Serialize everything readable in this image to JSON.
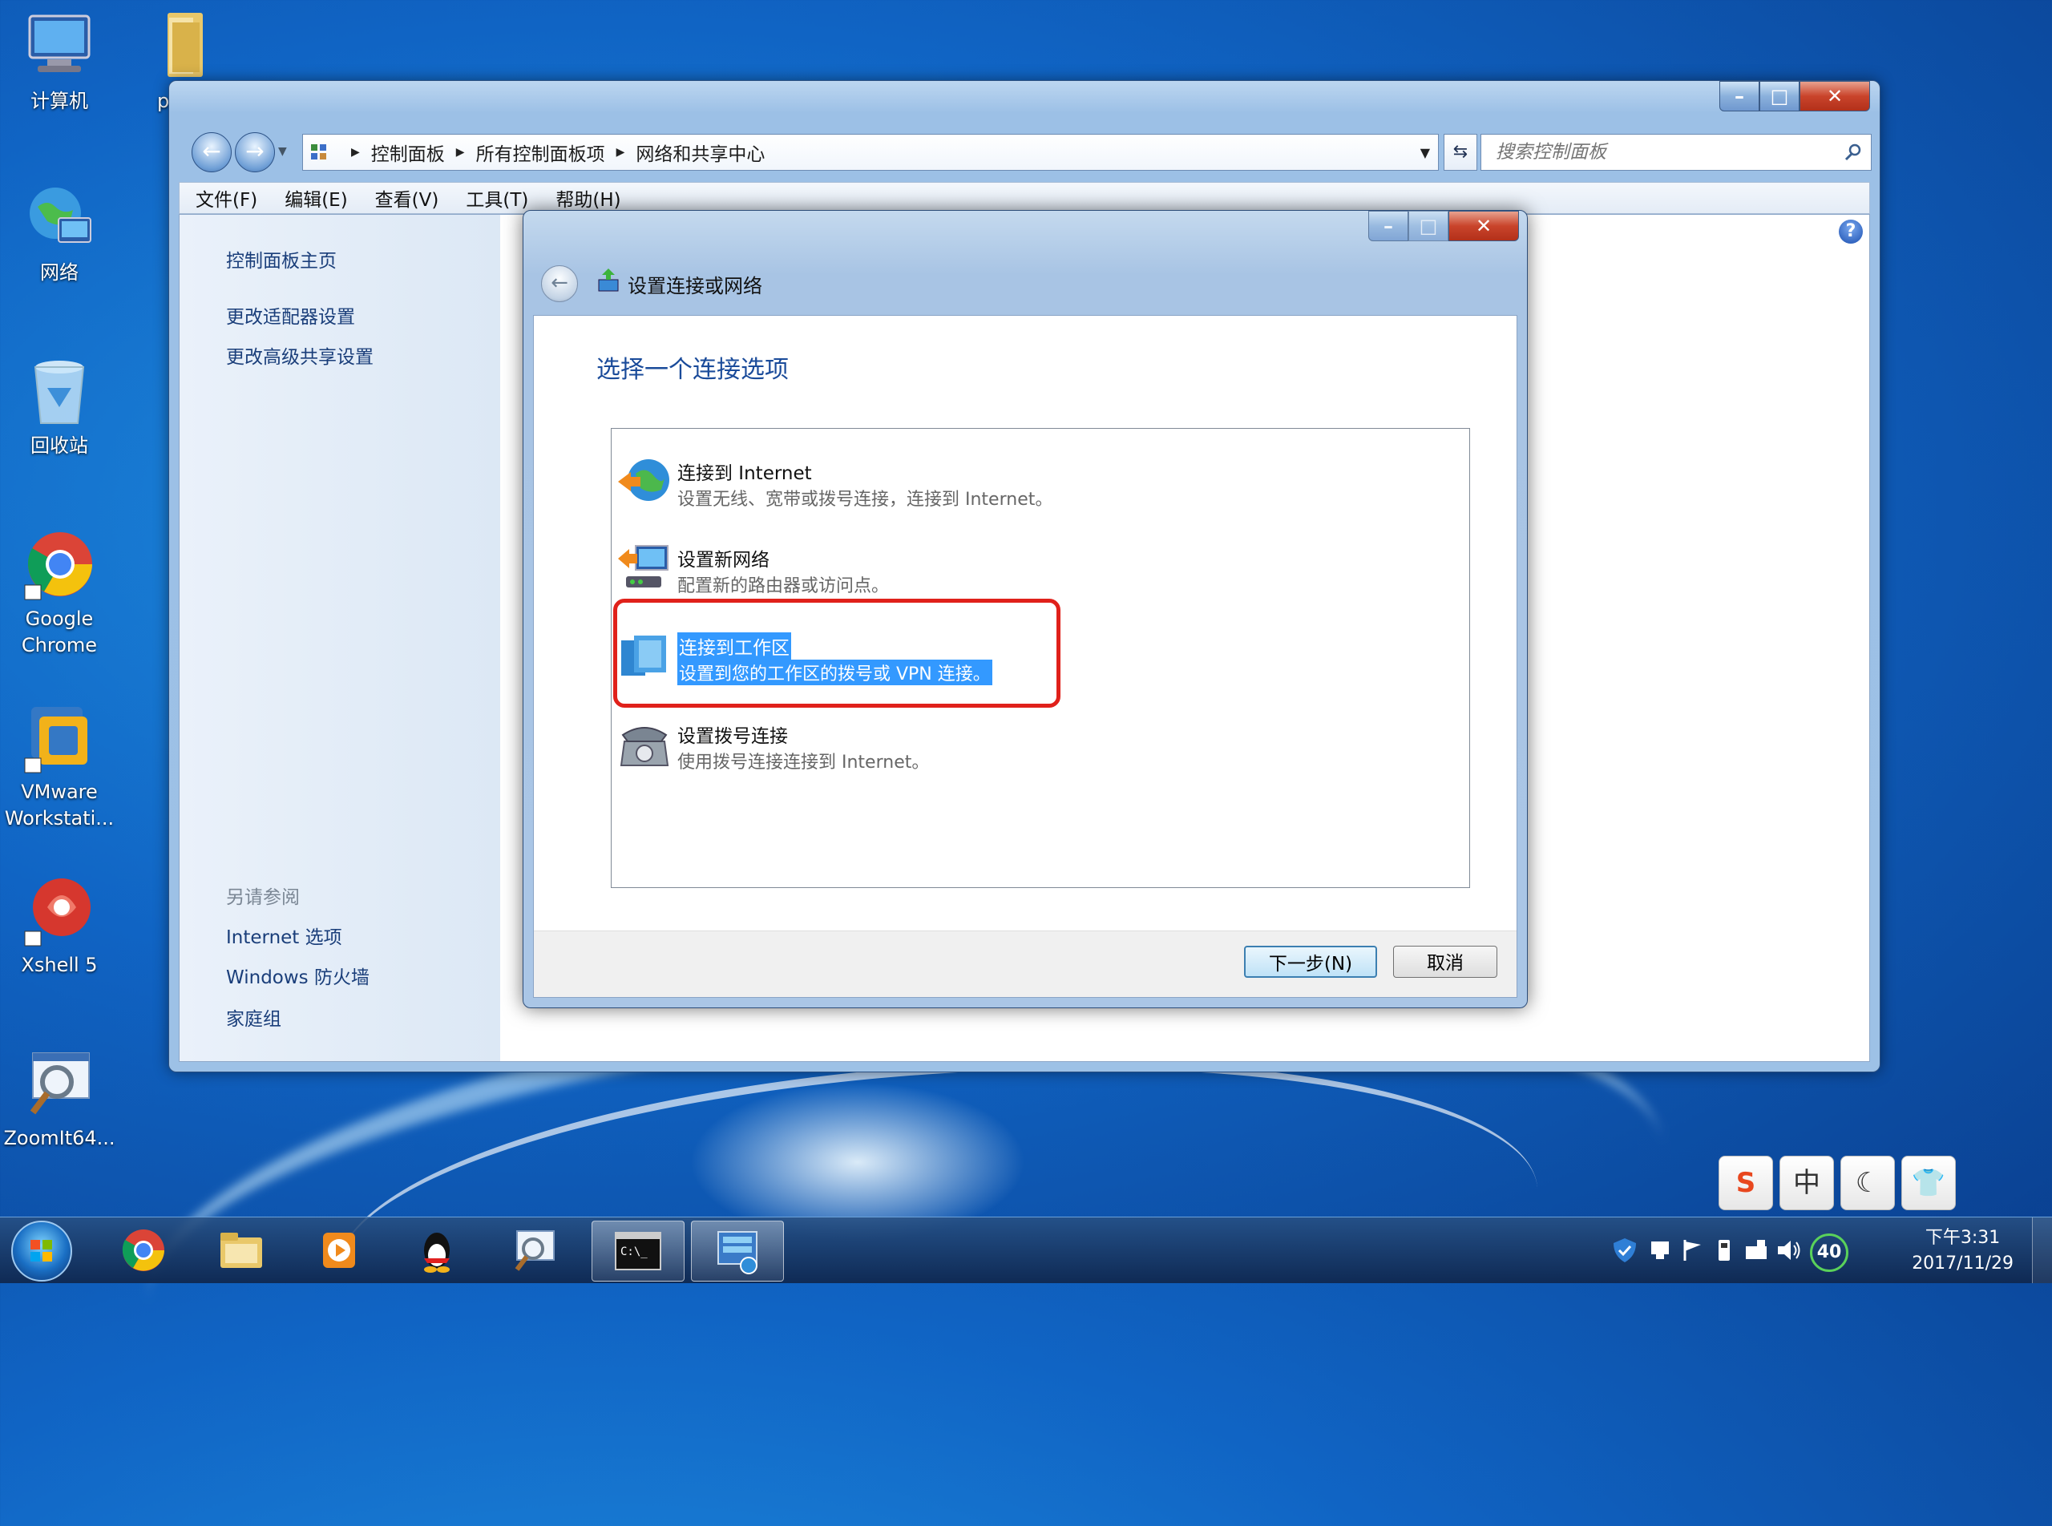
{
  "desktop": {
    "icons": [
      {
        "label": "计算机"
      },
      {
        "label": "p"
      },
      {
        "label": "网络"
      },
      {
        "label": "回收站"
      },
      {
        "label": "Google Chrome"
      },
      {
        "label": "VMware Workstati..."
      },
      {
        "label": "Xshell 5"
      },
      {
        "label": "ZoomIt64..."
      }
    ]
  },
  "explorer": {
    "breadcrumbs": [
      "控制面板",
      "所有控制面板项",
      "网络和共享中心"
    ],
    "search_placeholder": "搜索控制面板",
    "menu": [
      "文件(F)",
      "编辑(E)",
      "查看(V)",
      "工具(T)",
      "帮助(H)"
    ],
    "sidebar": {
      "links": [
        "控制面板主页",
        "更改适配器设置",
        "更改高级共享设置"
      ],
      "see_also_title": "另请参阅",
      "see_also": [
        "Internet 选项",
        "Windows 防火墙",
        "家庭组"
      ]
    }
  },
  "dialog": {
    "title": "设置连接或网络",
    "heading": "选择一个连接选项",
    "options": [
      {
        "title": "连接到 Internet",
        "desc": "设置无线、宽带或拨号连接，连接到 Internet。"
      },
      {
        "title": "设置新网络",
        "desc": "配置新的路由器或访问点。"
      },
      {
        "title": "连接到工作区",
        "desc": "设置到您的工作区的拨号或 VPN 连接。"
      },
      {
        "title": "设置拨号连接",
        "desc": "使用拨号连接连接到 Internet。"
      }
    ],
    "next_label": "下一步(N)",
    "cancel_label": "取消"
  },
  "ime": [
    "S",
    "中",
    "☾",
    "👕"
  ],
  "tray": {
    "badge": "40",
    "time": "下午3:31",
    "date": "2017/11/29"
  }
}
